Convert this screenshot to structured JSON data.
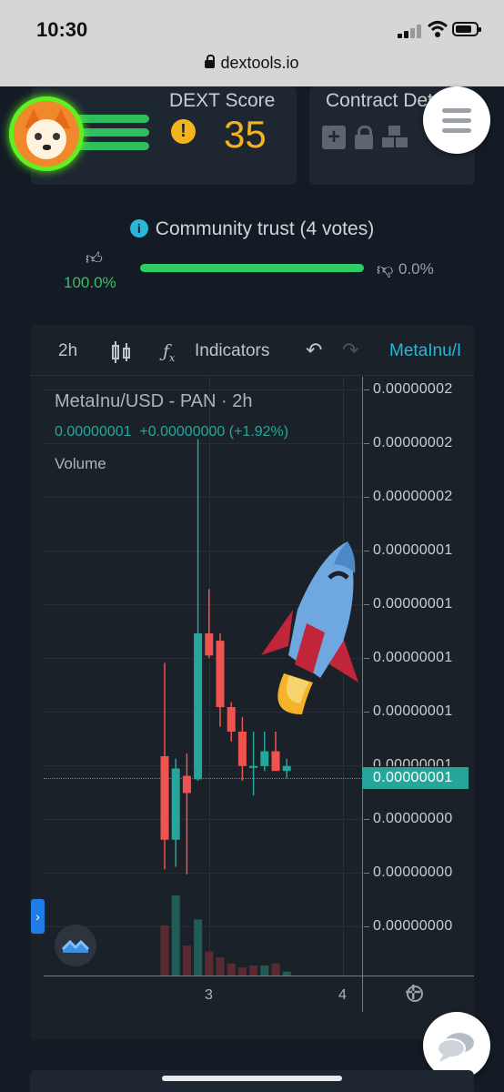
{
  "status": {
    "time": "10:30",
    "url": "dextools.io"
  },
  "header": {
    "score_title": "DEXT Score",
    "score_value": "35",
    "contract_title": "Contract Details",
    "icons": [
      "avatar",
      "warning-icon",
      "plus-icon",
      "lock-icon",
      "cubes-icon",
      "menu-icon"
    ]
  },
  "community": {
    "title": "Community trust (4 votes)",
    "up_pct": "100.0%",
    "down_pct": "0.0%",
    "trust_fraction": 1.0
  },
  "chart": {
    "toolbar": {
      "interval": "2h",
      "indicators": "Indicators",
      "symbol": "MetaInu/I"
    },
    "pair_title": "MetaInu/USD - PAN · 2h",
    "ohlc": "0.00000001  +0.00000000 (+1.92%)",
    "volume_label": "Volume",
    "y_labels": [
      "0.00000002",
      "0.00000002",
      "0.00000002",
      "0.00000001",
      "0.00000001",
      "0.00000001",
      "0.00000001",
      "0.00000001",
      "0.00000000",
      "0.00000000",
      "0.00000000"
    ],
    "current_price": "0.00000001",
    "x_labels": [
      "3",
      "4"
    ]
  },
  "colors": {
    "up": "#26a69a",
    "down": "#ef5350",
    "accent": "#29b6d8",
    "score": "#f2b51c",
    "trust": "#2fcb64"
  },
  "chart_data": {
    "type": "candlestick",
    "title": "MetaInu/USD - PAN · 2h",
    "x_ticks": [
      "3",
      "4"
    ],
    "y_ticks": [
      "0.00000002",
      "0.00000001",
      "0.00000000"
    ],
    "candles": [
      {
        "o": 0.35,
        "h": 0.54,
        "l": 0.12,
        "c": 0.18,
        "dir": "down"
      },
      {
        "o": 0.18,
        "h": 0.345,
        "l": 0.125,
        "c": 0.325,
        "dir": "up"
      },
      {
        "o": 0.31,
        "h": 0.355,
        "l": 0.11,
        "c": 0.275,
        "dir": "down"
      },
      {
        "o": 0.303,
        "h": 0.995,
        "l": 0.3,
        "c": 0.6,
        "dir": "up"
      },
      {
        "o": 0.6,
        "h": 0.69,
        "l": 0.55,
        "c": 0.555,
        "dir": "down"
      },
      {
        "o": 0.585,
        "h": 0.6,
        "l": 0.41,
        "c": 0.45,
        "dir": "down"
      },
      {
        "o": 0.45,
        "h": 0.46,
        "l": 0.38,
        "c": 0.4,
        "dir": "down"
      },
      {
        "o": 0.4,
        "h": 0.43,
        "l": 0.3,
        "c": 0.33,
        "dir": "down"
      },
      {
        "o": 0.33,
        "h": 0.4,
        "l": 0.27,
        "c": 0.33,
        "dir": "flat"
      },
      {
        "o": 0.33,
        "h": 0.4,
        "l": 0.32,
        "c": 0.36,
        "dir": "up"
      },
      {
        "o": 0.36,
        "h": 0.4,
        "l": 0.32,
        "c": 0.32,
        "dir": "down"
      },
      {
        "o": 0.32,
        "h": 0.345,
        "l": 0.305,
        "c": 0.33,
        "dir": "up"
      }
    ],
    "volume": [
      0.25,
      0.4,
      0.15,
      0.28,
      0.12,
      0.09,
      0.06,
      0.04,
      0.05,
      0.05,
      0.06,
      0.02
    ]
  }
}
